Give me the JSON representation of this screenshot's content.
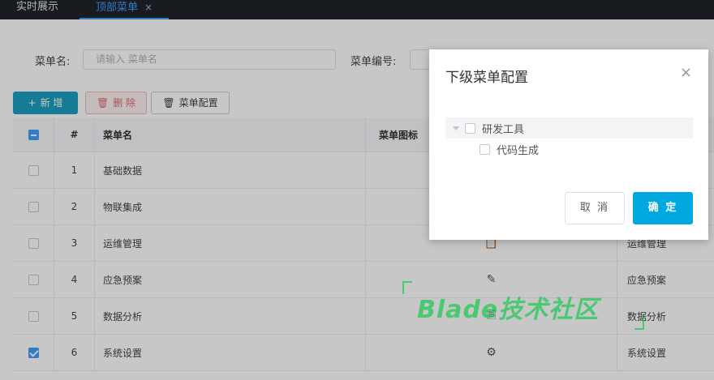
{
  "tabs": [
    {
      "label": "实时展示"
    },
    {
      "label": "顶部菜单",
      "close": "×"
    }
  ],
  "search": {
    "menu_name_label": "菜单名:",
    "menu_name_placeholder": "请输入 菜单名",
    "menu_code_label": "菜单编号:"
  },
  "toolbar": {
    "add_icon": "+",
    "add_label": "新 增",
    "delete_icon": "trash-icon",
    "delete_label": "删 除",
    "config_icon": "trash-icon",
    "config_label": "菜单配置"
  },
  "table": {
    "headers": {
      "index": "#",
      "name": "菜单名",
      "icon": "菜单图标"
    },
    "rows": [
      {
        "index": "1",
        "name": "基础数据",
        "code": "",
        "checked": false,
        "icon": ""
      },
      {
        "index": "2",
        "name": "物联集成",
        "code": "",
        "checked": false,
        "icon": ""
      },
      {
        "index": "3",
        "name": "运维管理",
        "code": "运维管理",
        "checked": false,
        "icon": "clipboard-icon"
      },
      {
        "index": "4",
        "name": "应急预案",
        "code": "应急预案",
        "checked": false,
        "icon": "edit-icon"
      },
      {
        "index": "5",
        "name": "数据分析",
        "code": "数据分析",
        "checked": false,
        "icon": "document-icon"
      },
      {
        "index": "6",
        "name": "系统设置",
        "code": "系统设置",
        "checked": true,
        "icon": "gear-icon"
      }
    ]
  },
  "dialog": {
    "title": "下级菜单配置",
    "close": "×",
    "tree": [
      {
        "label": "研发工具",
        "children": [
          {
            "label": "代码生成"
          }
        ]
      }
    ],
    "cancel_label": "取 消",
    "ok_label": "确 定"
  },
  "watermark": {
    "text": "Blade技术社区"
  },
  "colors": {
    "accent": "#1b9ec2",
    "primary": "#409eff",
    "ok_button": "#00a8e0",
    "danger": "#e06d6d"
  }
}
